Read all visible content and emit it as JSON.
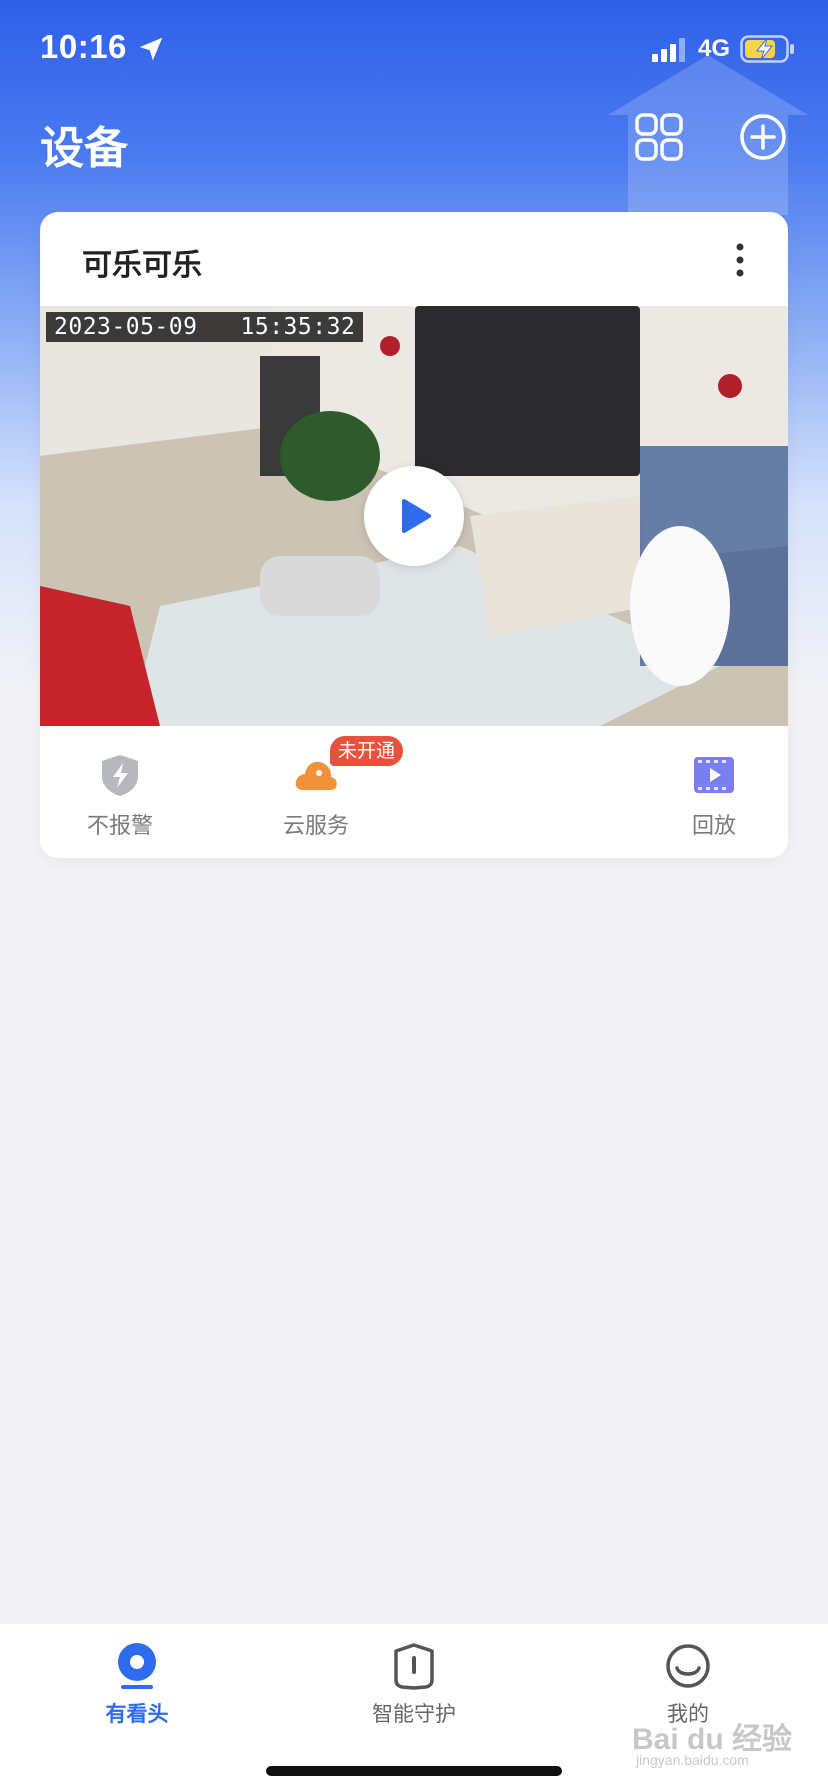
{
  "status_bar": {
    "time": "10:16",
    "network": "4G",
    "icons": [
      "location-arrow-icon",
      "signal-icon",
      "battery-charging-icon"
    ]
  },
  "header": {
    "title": "设备",
    "icons": [
      "grid-layout-icon",
      "add-circle-icon"
    ]
  },
  "device": {
    "name": "可乐可乐",
    "preview_timestamp": "2023-05-09   15:35:32",
    "actions": [
      {
        "label": "不报警",
        "icon": "alarm-off-shield-icon"
      },
      {
        "label": "云服务",
        "icon": "cloud-icon",
        "badge": "未开通"
      },
      {
        "label": "回放",
        "icon": "playback-video-icon"
      }
    ]
  },
  "tabbar": {
    "tabs": [
      {
        "label": "有看头",
        "icon": "camera-eye-icon",
        "active": true
      },
      {
        "label": "智能守护",
        "icon": "guard-shield-icon",
        "active": false
      },
      {
        "label": "我的",
        "icon": "smile-profile-icon",
        "active": false
      }
    ]
  },
  "watermark": {
    "text": "Bai du 经验",
    "sub": "jingyan.baidu.com"
  },
  "colors": {
    "primary": "#2f6bed",
    "badge": "#e5533d",
    "cloud": "#f2913a",
    "playback": "#7b7ef0"
  }
}
